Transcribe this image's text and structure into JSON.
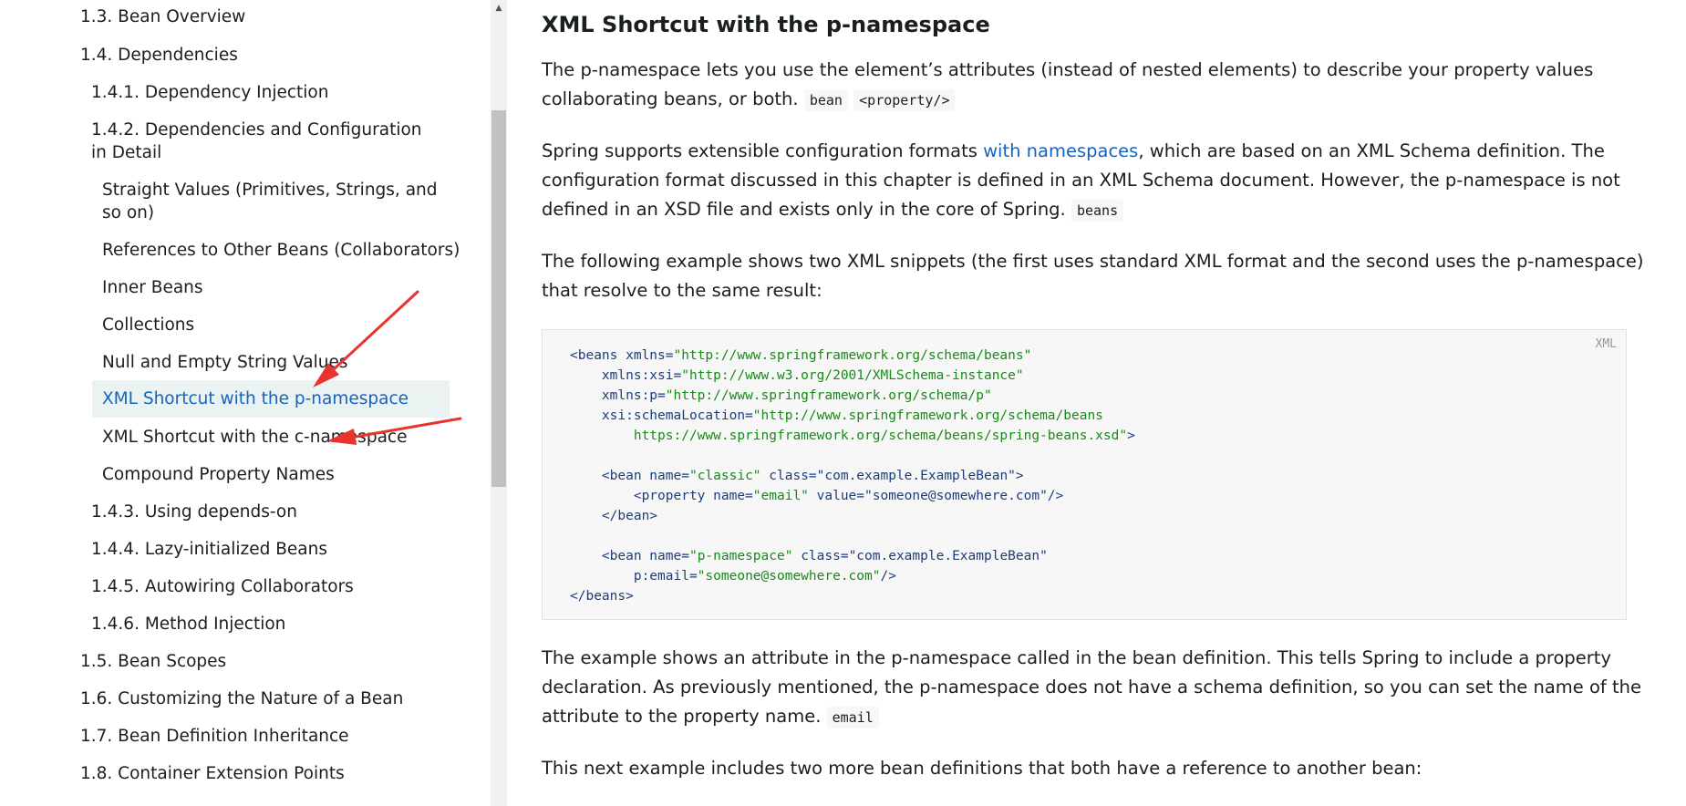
{
  "sidebar": {
    "items": [
      {
        "label": "1.3. Bean Overview"
      },
      {
        "label": "1.4. Dependencies"
      },
      {
        "label": "1.4.1. Dependency Injection"
      },
      {
        "label": "1.4.2. Dependencies and Configuration in Detail"
      },
      {
        "label": "Straight Values (Primitives, Strings, and so on)"
      },
      {
        "label": "References to Other Beans (Collaborators)"
      },
      {
        "label": "Inner Beans"
      },
      {
        "label": "Collections"
      },
      {
        "label": "Null and Empty String Values"
      },
      {
        "label": "XML Shortcut with the p-namespace"
      },
      {
        "label": "XML Shortcut with the c-namespace"
      },
      {
        "label": "Compound Property Names"
      },
      {
        "label": "1.4.3. Using depends-on"
      },
      {
        "label": "1.4.4. Lazy-initialized Beans"
      },
      {
        "label": "1.4.5. Autowiring Collaborators"
      },
      {
        "label": "1.4.6. Method Injection"
      },
      {
        "label": "1.5. Bean Scopes"
      },
      {
        "label": "1.6. Customizing the Nature of a Bean"
      },
      {
        "label": "1.7. Bean Definition Inheritance"
      },
      {
        "label": "1.8. Container Extension Points"
      }
    ],
    "active": "XML Shortcut with the p-namespace"
  },
  "main": {
    "heading": "XML Shortcut with the p-namespace",
    "p1": {
      "text1": "The p-namespace lets you use the element’s attributes (instead of nested elements) to describe your property values collaborating beans, or both.",
      "code1": "bean",
      "code2": "<property/>"
    },
    "p2": {
      "text1": "Spring supports extensible configuration formats",
      "link": "with namespaces",
      "text2": ", which are based on an XML Schema definition. The configuration format discussed in this chapter is defined in an XML Schema document. However, the p-namespace is not defined in an XSD file and exists only in the core of Spring.",
      "code": "beans"
    },
    "p3": {
      "text": "The following example shows two XML snippets (the first uses standard XML format and the second uses the p-namespace) that resolve to the same result:"
    },
    "codeblock": {
      "lang": "XML",
      "lines": [
        {
          "t": "<beans",
          "a": " xmlns=",
          "v": "\"http://www.springframework.org/schema/beans\"",
          "e": ""
        },
        {
          "t": "    ",
          "a": "xmlns:xsi=",
          "v": "\"http://www.w3.org/2001/XMLSchema-instance\"",
          "e": ""
        },
        {
          "t": "    ",
          "a": "xmlns:p=",
          "v": "\"http://www.springframework.org/schema/p\"",
          "e": ""
        },
        {
          "t": "    ",
          "a": "xsi:schemaLocation=",
          "v": "\"http://www.springframework.org/schema/beans",
          "e": ""
        },
        {
          "t": "        ",
          "a": "",
          "v": "https://www.springframework.org/schema/beans/spring-beans.xsd\"",
          "e": ">"
        },
        {
          "t": "",
          "a": "",
          "v": "",
          "e": ""
        },
        {
          "t": "    <bean",
          "a": " name=",
          "v": "\"classic\"",
          "e": " class=\"com.example.ExampleBean\">"
        },
        {
          "t": "        <property",
          "a": " name=",
          "v": "\"email\"",
          "e": " value=\"someone@somewhere.com\"/>"
        },
        {
          "t": "    </bean>",
          "a": "",
          "v": "",
          "e": ""
        },
        {
          "t": "",
          "a": "",
          "v": "",
          "e": ""
        },
        {
          "t": "    <bean",
          "a": " name=",
          "v": "\"p-namespace\"",
          "e": " class=\"com.example.ExampleBean\""
        },
        {
          "t": "        ",
          "a": "p:email=",
          "v": "\"someone@somewhere.com\"",
          "e": "/>"
        },
        {
          "t": "</beans>",
          "a": "",
          "v": "",
          "e": ""
        }
      ]
    },
    "p4": {
      "text": "The example shows an attribute in the p-namespace called in the bean definition. This tells Spring to include a property declaration. As previously mentioned, the p-namespace does not have a schema definition, so you can set the name of the attribute to the property name.",
      "code": "email"
    },
    "p5": {
      "text": "This next example includes two more bean definitions that both have a reference to another bean:"
    }
  },
  "annotations": {
    "arrow_color": "#e8332e"
  }
}
